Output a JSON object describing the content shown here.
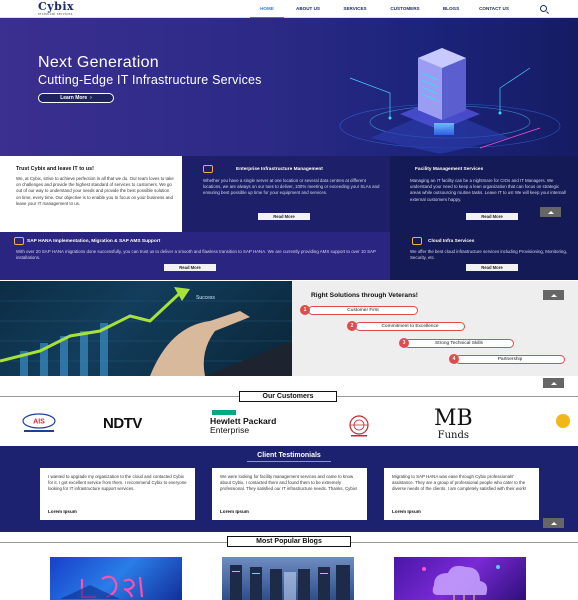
{
  "nav": {
    "logo_main": "Cybix",
    "logo_sub": "technical services",
    "items": [
      "HOME",
      "ABOUT US",
      "SERVICES",
      "CUSTOMERS",
      "BLOGS",
      "CONTACT US"
    ]
  },
  "hero": {
    "line1": "Next Generation",
    "line2": "Cutting-Edge IT Infrastructure Services",
    "button": "Learn More"
  },
  "services": {
    "trust": {
      "title": "Trust Cybix and leave IT to us!",
      "body": "We, at Cybix, strive to achieve perfection in all that we do. Our team loves to take on challenges and provide the highest standard of services to customers. We go out of our way to understand your needs and provide the best possible solution on time, every time. Our objective is to enable you to focus on your business and leave your IT management to us."
    },
    "eim": {
      "title": "Enterprise Infrastructure Management",
      "body": "Whether you have a single server at one location or several data centres at different locations, we are always on our toes to deliver, 100% meeting or exceeding your SLAs and ensuring best possible up time for your equipment and services.",
      "button": "Read More"
    },
    "fms": {
      "title": "Facility Management Services",
      "body": "Managing an IT facility can be a nightmare for CIOs and IT Managers. We understand your need to keep a lean organization that can focus on strategic areas while outsourcing routine tasks. Leave IT to us! We will keep your internal/ external customers happy.",
      "button": "Read More"
    },
    "sap": {
      "title": "SAP HANA Implementation, Migration & SAP AMS Support",
      "body": "With over 20 SAP HANA migrations done successfully, you can trust us to deliver a smooth and flawless transition to SAP HANA. We are currently providing AMS support to over 10 SAP installations.",
      "button": "Read More"
    },
    "cis": {
      "title": "Cloud Infra Services",
      "body": "We offer the best cloud infrastructure services including Provisioning, Monitoring, Security, etc.",
      "button": "Read More"
    }
  },
  "right_solutions": {
    "title": "Right Solutions through Veterans!",
    "image_caption": "Success",
    "items": [
      {
        "num": "1",
        "label": "Customer First"
      },
      {
        "num": "2",
        "label": "Commitment to Excellence"
      },
      {
        "num": "3",
        "label": "Strong Technical Skills"
      },
      {
        "num": "4",
        "label": "Partnership"
      }
    ]
  },
  "customers": {
    "title": "Our Customers",
    "logos": [
      "AIS",
      "NDTV",
      "Hewlett Packard",
      "Enterprise",
      "MB",
      "Funds"
    ]
  },
  "testimonials": {
    "title": "Client Testimonials",
    "cards": [
      {
        "text": "I wanted to upgrade my organization to the cloud and contacted Cybix for it. I got excellent service from them. I recommend Cybix to everyone looking for IT infrastructure support services.",
        "name": "Lorem Ipsum"
      },
      {
        "text": "We were looking for facility management services and came to know about Cybix. I contacted them and found them to be extremely professional. They satisfied our IT infrastructure needs. Thanks, Cybix!",
        "name": "Lorem Ipsum"
      },
      {
        "text": "Migrating to SAP HANA was ease through Cybix professionals' assistance. They are a group of professional people who cater to the diverse needs of the clients. I am completely satisfied with their work!",
        "name": "Lorem Ipsum"
      }
    ]
  },
  "blogs": {
    "title": "Most Popular Blogs"
  },
  "colors": {
    "navy": "#1c2b6e",
    "accent_blue": "#3b7bd6",
    "pill_red": "#e14b4b",
    "hero_purple": "#2c2a86"
  }
}
